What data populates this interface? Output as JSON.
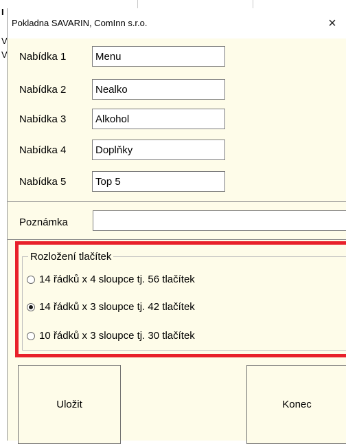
{
  "window": {
    "title": "Pokladna SAVARIN, ComInn s.r.o.",
    "close_glyph": "×"
  },
  "background": {
    "edge_chars": [
      "I",
      "V",
      "V"
    ]
  },
  "menus": [
    {
      "label": "Nabídka 1",
      "value": "Menu"
    },
    {
      "label": "Nabídka 2",
      "value": "Nealko"
    },
    {
      "label": "Nabídka 3",
      "value": "Alkohol"
    },
    {
      "label": "Nabídka 4",
      "value": "Doplňky"
    },
    {
      "label": "Nabídka 5",
      "value": "Top 5"
    }
  ],
  "note": {
    "label": "Poznámka",
    "value": ""
  },
  "layout_group": {
    "title": "Rozložení tlačítek",
    "options": [
      {
        "label": "14 řádků x 4 sloupce tj. 56 tlačítek",
        "checked": false
      },
      {
        "label": "14 řádků x 3 sloupce tj. 42 tlačítek",
        "checked": true
      },
      {
        "label": "10 řádků x 3 sloupce tj. 30 tlačítek",
        "checked": false
      }
    ]
  },
  "buttons": {
    "save": "Uložit",
    "close": "Konec"
  },
  "colors": {
    "window_bg": "#fefce9",
    "highlight": "#e8202a"
  }
}
